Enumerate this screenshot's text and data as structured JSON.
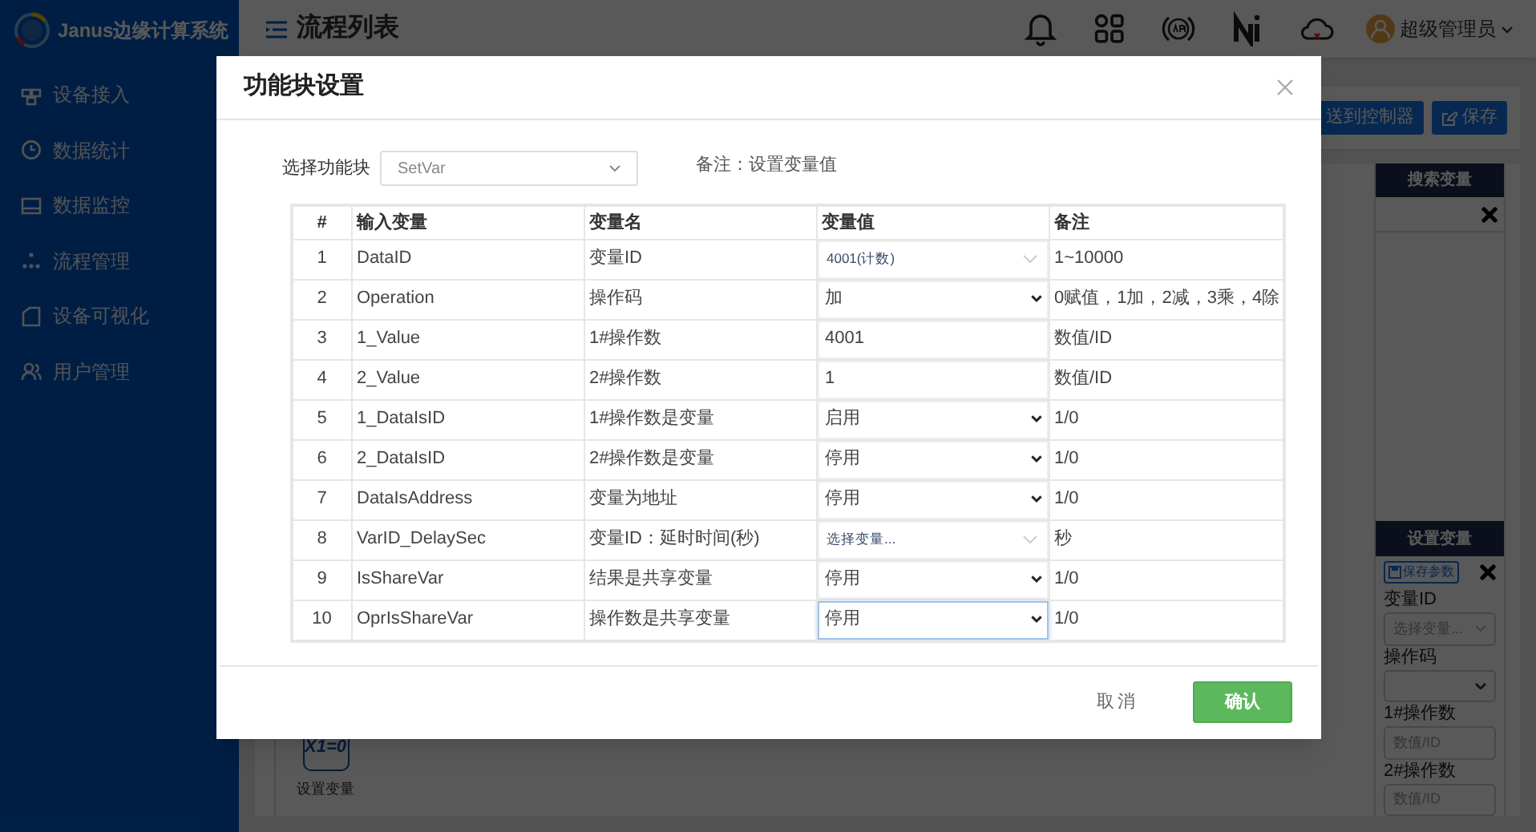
{
  "app": {
    "title": "Janus边缘计算系统"
  },
  "sidebar": {
    "items": [
      {
        "label": "设备接入"
      },
      {
        "label": "数据统计"
      },
      {
        "label": "数据监控"
      },
      {
        "label": "流程管理"
      },
      {
        "label": "设备可视化"
      },
      {
        "label": "用户管理"
      }
    ]
  },
  "header": {
    "title": "流程列表",
    "user": "超级管理员"
  },
  "toolbar": {
    "buttons": [
      {
        "label": "送到控制器"
      },
      {
        "label": "保存"
      }
    ]
  },
  "canvas": {
    "blocks": [
      {
        "symbol": "X1=0",
        "label": "设置变量"
      }
    ]
  },
  "right_panel": {
    "search_title": "搜索变量",
    "set_title": "设置变量",
    "save_button": "保存参数",
    "fields": [
      {
        "label": "变量ID",
        "kind": "combo",
        "placeholder": "选择变量..."
      },
      {
        "label": "操作码",
        "kind": "select"
      },
      {
        "label": "1#操作数",
        "kind": "input",
        "placeholder": "数值/ID"
      },
      {
        "label": "2#操作数",
        "kind": "input",
        "placeholder": "数值/ID"
      }
    ]
  },
  "dialog": {
    "title": "功能块设置",
    "select_label": "选择功能块",
    "select_value": "SetVar",
    "note": "备注：设置变量值",
    "columns": [
      "#",
      "输入变量",
      "变量名",
      "变量值",
      "备注"
    ],
    "rows": [
      {
        "index": "1",
        "input": "DataID",
        "name": "变量ID",
        "value": {
          "kind": "combo",
          "text": "4001(计数)",
          "focused": false
        },
        "note": "1~10000"
      },
      {
        "index": "2",
        "input": "Operation",
        "name": "操作码",
        "value": {
          "kind": "select",
          "text": "加",
          "focused": false
        },
        "note": "0赋值，1加，2减，3乘，4除"
      },
      {
        "index": "3",
        "input": "1_Value",
        "name": "1#操作数",
        "value": {
          "kind": "input",
          "text": "4001",
          "focused": false
        },
        "note": "数值/ID"
      },
      {
        "index": "4",
        "input": "2_Value",
        "name": "2#操作数",
        "value": {
          "kind": "input",
          "text": "1",
          "focused": false
        },
        "note": "数值/ID"
      },
      {
        "index": "5",
        "input": "1_DataIsID",
        "name": "1#操作数是变量",
        "value": {
          "kind": "select",
          "text": "启用",
          "focused": false
        },
        "note": "1/0"
      },
      {
        "index": "6",
        "input": "2_DataIsID",
        "name": "2#操作数是变量",
        "value": {
          "kind": "select",
          "text": "停用",
          "focused": false
        },
        "note": "1/0"
      },
      {
        "index": "7",
        "input": "DataIsAddress",
        "name": "变量为地址",
        "value": {
          "kind": "select",
          "text": "停用",
          "focused": false
        },
        "note": "1/0"
      },
      {
        "index": "8",
        "input": "VarID_DelaySec",
        "name": "变量ID：延时时间(秒)",
        "value": {
          "kind": "combo",
          "text": "选择变量...",
          "focused": false
        },
        "note": "秒"
      },
      {
        "index": "9",
        "input": "IsShareVar",
        "name": "结果是共享变量",
        "value": {
          "kind": "select",
          "text": "停用",
          "focused": false
        },
        "note": "1/0"
      },
      {
        "index": "10",
        "input": "OprIsShareVar",
        "name": "操作数是共享变量",
        "value": {
          "kind": "select",
          "text": "停用",
          "focused": true
        },
        "note": "1/0"
      }
    ],
    "buttons": [
      {
        "label": "取消",
        "kind": "secondary"
      },
      {
        "label": "确认",
        "kind": "primary"
      }
    ]
  }
}
